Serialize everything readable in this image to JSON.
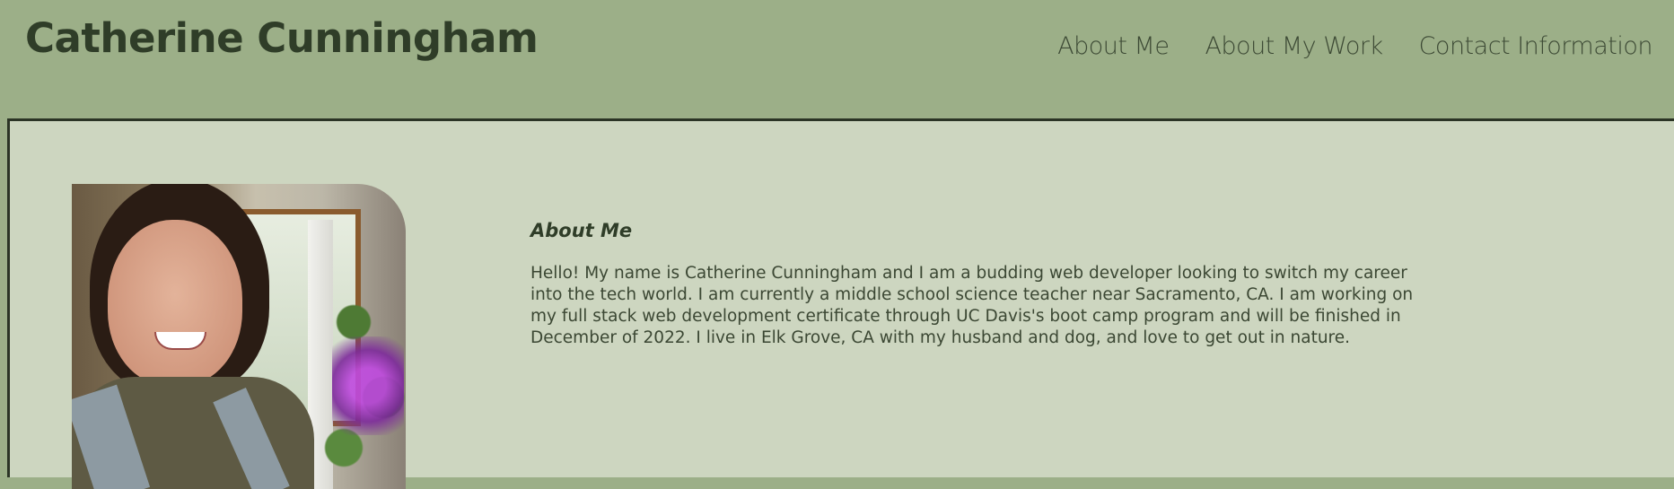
{
  "header": {
    "title": "Catherine Cunningham",
    "nav": [
      {
        "label": "About Me"
      },
      {
        "label": "About My Work"
      },
      {
        "label": "Contact Information"
      }
    ]
  },
  "about": {
    "heading": "About Me",
    "text": "Hello! My name is Catherine Cunningham and I am a budding web developer looking to switch my career into the tech world. I am currently a middle school science teacher near Sacramento, CA. I am working on my full stack web development certificate through UC Davis's boot camp program and will be finished in December of 2022. I live in Elk Grove, CA with my husband and dog, and love to get out in nature."
  },
  "colors": {
    "header_bg": "#9caf88",
    "main_bg": "#cdd6c0",
    "text_dark": "#2f3d28"
  }
}
